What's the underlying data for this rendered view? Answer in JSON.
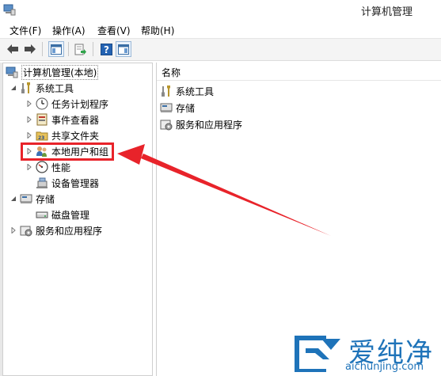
{
  "window": {
    "title": "计算机管理"
  },
  "menu": [
    {
      "label": "文件(F)"
    },
    {
      "label": "操作(A)"
    },
    {
      "label": "查看(V)"
    },
    {
      "label": "帮助(H)"
    }
  ],
  "toolbar": {
    "buttons": [
      "back-arrow-icon",
      "forward-arrow-icon",
      "show-console-tree-icon",
      "export-list-icon",
      "help-icon",
      "properties-pane-icon"
    ]
  },
  "tree": {
    "root": "计算机管理(本地)",
    "system_tools": "系统工具",
    "task_scheduler": "任务计划程序",
    "event_viewer": "事件查看器",
    "shared_folders": "共享文件夹",
    "local_users": "本地用户和组",
    "performance": "性能",
    "device_manager": "设备管理器",
    "storage": "存储",
    "disk_management": "磁盘管理",
    "services_apps": "服务和应用程序"
  },
  "list": {
    "column_name": "名称",
    "items": [
      "系统工具",
      "存储",
      "服务和应用程序"
    ]
  },
  "annotation": {
    "highlight_color": "#e8232a"
  },
  "watermark": {
    "title": "爱纯净",
    "url": "aichunjing.com",
    "color": "#1e73b9"
  }
}
